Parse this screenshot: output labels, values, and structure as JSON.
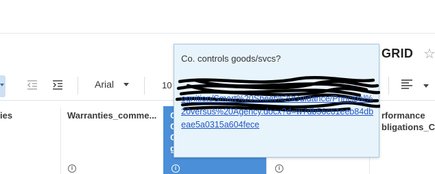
{
  "header": {
    "sheet_title": "GRID",
    "favorite_icon": "star-outline-icon"
  },
  "toolbar": {
    "outdent_icon": "decrease-indent-icon",
    "indent_icon": "increase-indent-icon",
    "font_family": "Arial",
    "font_size": "10",
    "align_icon": "align-left-icon"
  },
  "columns": [
    {
      "label": "ies"
    },
    {
      "label": "Warranties_comme..."
    },
    {
      "label": "Performance obligations_Co",
      "label_line1": "rformance",
      "label_line2": "bligations_C"
    }
  ],
  "selected_column": {
    "letters": [
      "C",
      "C",
      "C",
      "g"
    ]
  },
  "tooltip": {
    "title": "Co. controls goods/svcs?",
    "link_text": "https://...sharepoint.com/...ognition/Smart%20Sheet%20Guidance/Principal%20versus%20Agency.docx?d=w7db56c61eeb84dbeae5a0315a604fece",
    "link_visible": "ognition/Smart%20Sheet%20Guidance/Principal%20versus%20Agency.docx?d=w7db56c61eeb84dbeae5a0315a604fece"
  },
  "colors": {
    "selected_column": "#4a8fd8",
    "tooltip_bg": "#e8f4fb",
    "link": "#2155c5"
  }
}
